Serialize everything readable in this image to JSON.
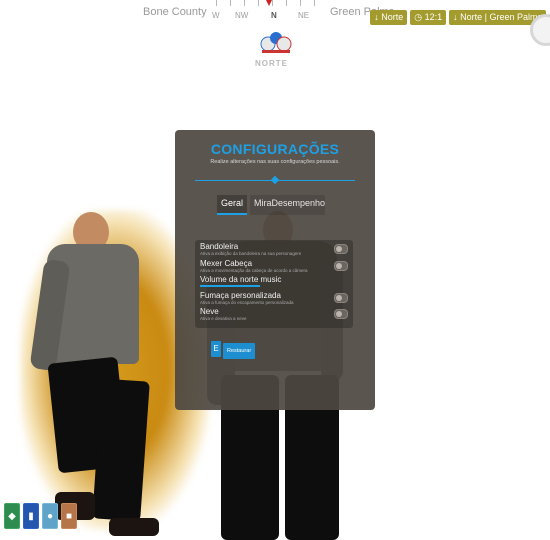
{
  "hud": {
    "zone_left": "Bone County",
    "zone_right": "Green Palms",
    "compass_dirs": [
      "W",
      "NW",
      "N",
      "NE"
    ],
    "badges": [
      "↓ Norte",
      "◷ 12:1",
      "↓ Norte | Green Palms"
    ]
  },
  "logo": {
    "text": "NORTE"
  },
  "settings": {
    "title": "CONFIGURAÇÕES",
    "subtitle": "Realize alterações nas suas configurações pessoais.",
    "tabs": [
      {
        "label": "Geral",
        "active": true
      },
      {
        "label": "Mira",
        "active": false
      },
      {
        "label": "Desempenho",
        "active": false
      }
    ],
    "options": [
      {
        "label": "Bandoleira",
        "description": "Ativa a exibição da bandoleira na sua personagem",
        "control": "toggle",
        "enabled": false
      },
      {
        "label": "Mexer Cabeça",
        "description": "Ativa a movimentação da cabeça de acordo a câmera",
        "control": "toggle",
        "enabled": false
      },
      {
        "label": "Volume da norte music",
        "description": "",
        "control": "slider",
        "value": 40
      },
      {
        "label": "Fumaça personalizada",
        "description": "Ativa a fumaça do escapamento personalizada",
        "control": "toggle",
        "enabled": false
      },
      {
        "label": "Neve",
        "description": "Ativa e desativa a neve",
        "control": "toggle",
        "enabled": false
      }
    ],
    "key_hint": "E",
    "action_label": "Restaurar"
  },
  "bottom_icons": [
    {
      "icon": "shield-icon",
      "color": "#2e8c4e"
    },
    {
      "icon": "bottle-icon",
      "color": "#2456b0"
    },
    {
      "icon": "water-drop-icon",
      "color": "#5fa4c8"
    },
    {
      "icon": "food-icon",
      "color": "#b67548"
    }
  ]
}
